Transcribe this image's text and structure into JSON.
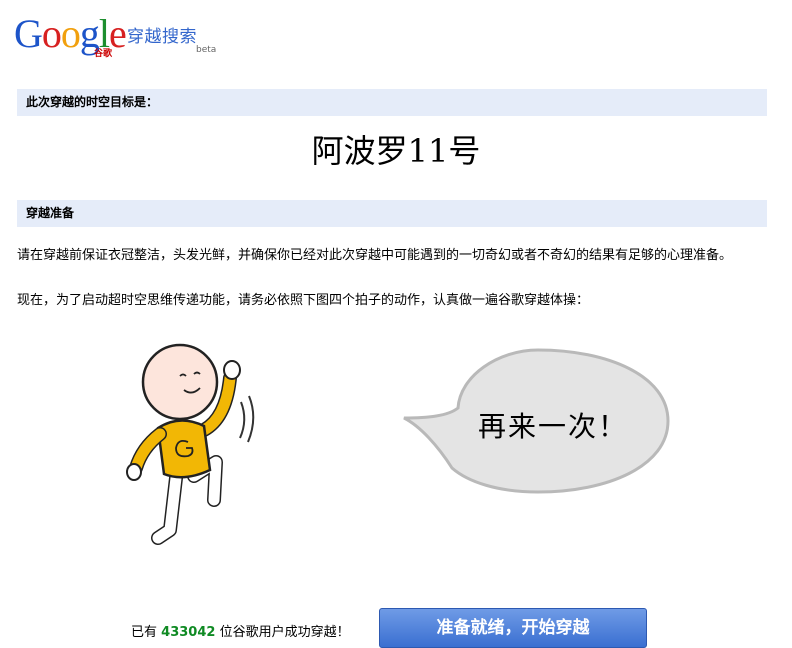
{
  "logo": {
    "google": [
      "G",
      "o",
      "o",
      "g",
      "l",
      "e"
    ],
    "google_colors": [
      "#1d54c9",
      "#d72121",
      "#f1a00e",
      "#1d54c9",
      "#1d8e2e",
      "#d72121"
    ],
    "sub": "谷歌",
    "product": "穿越搜索",
    "beta": "beta"
  },
  "target": {
    "heading": "此次穿越的时空目标是：",
    "destination": "阿波罗11号"
  },
  "prep": {
    "heading": "穿越准备",
    "paragraph1": "请在穿越前保证衣冠整洁，头发光鲜，并确保你已经对此次穿越中可能遇到的一切奇幻或者不奇幻的结果有足够的心理准备。",
    "paragraph2": "现在，为了启动超时空思维传递功能，请务必依照下图四个拍子的动作，认真做一遍谷歌穿越体操："
  },
  "bubble": {
    "text": "再来一次！"
  },
  "footer": {
    "prefix": "已有",
    "count": "433042",
    "suffix": "位谷歌用户成功穿越！",
    "button": "准备就绪，开始穿越"
  },
  "colors": {
    "bar_bg": "#e5ecf9",
    "shirt": "#f2b705",
    "count": "#0f8a23",
    "button": "#3a6fd1"
  }
}
